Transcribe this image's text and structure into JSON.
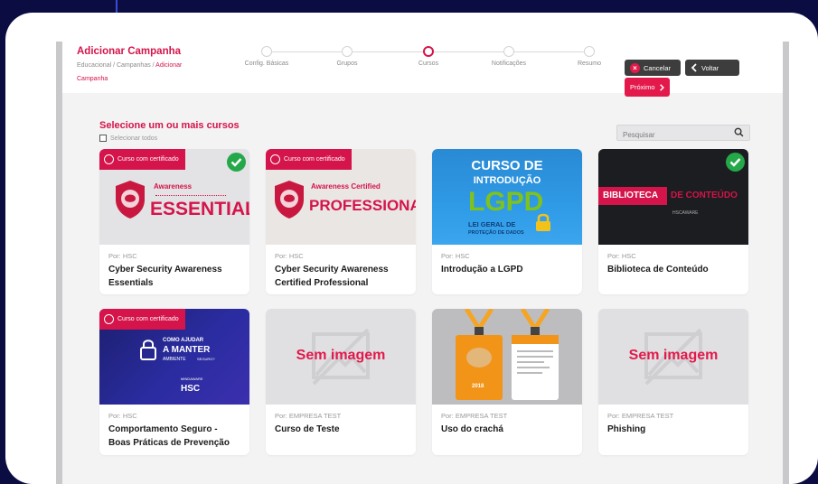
{
  "header": {
    "title": "Adicionar Campanha",
    "breadcrumb": {
      "path": "Educacional / Campanhas / ",
      "current": "Adicionar Campanha"
    }
  },
  "steps": [
    {
      "label": "Config. Básicas",
      "active": false
    },
    {
      "label": "Grupos",
      "active": false
    },
    {
      "label": "Cursos",
      "active": true
    },
    {
      "label": "Notificações",
      "active": false
    },
    {
      "label": "Resumo",
      "active": false
    }
  ],
  "actions": {
    "cancel": "Cancelar",
    "back": "Voltar",
    "next": "Próximo"
  },
  "content": {
    "title": "Selecione um ou mais cursos",
    "select_all": "Selecionar todos",
    "search_placeholder": "Pesquisar"
  },
  "colors": {
    "accent": "#d4144a",
    "success": "#25a84a",
    "dark_button": "#3d3d3d"
  },
  "courses": [
    {
      "by": "Por: HSC",
      "name": "Cyber Security Awareness Essentials",
      "certificate": "Curso com certificado",
      "selected": true,
      "image_text": {
        "small": "Awareness",
        "big": "ESSENTIALS"
      }
    },
    {
      "by": "Por: HSC",
      "name": "Cyber Security Awareness Certified Professional",
      "certificate": "Curso com certificado",
      "selected": false,
      "image_text": {
        "small": "Awareness Certified",
        "big": "PROFESSIONAL"
      }
    },
    {
      "by": "Por: HSC",
      "name": "Introdução a LGPD",
      "certificate": "",
      "selected": false,
      "image_text": {
        "line1": "CURSO DE",
        "line2": "INTRODUÇÃO",
        "big": "LGPD",
        "line3": "LEI GERAL DE",
        "line4": "PROTEÇÃO DE DADOS"
      }
    },
    {
      "by": "Por: HSC",
      "name": "Biblioteca de Conteúdo",
      "certificate": "",
      "selected": true,
      "image_text": {
        "left": "BIBLIOTECA",
        "right": "DE CONTEÚDO",
        "brand": "HSCAWARE"
      }
    },
    {
      "by": "Por: HSC",
      "name": "Comportamento Seguro - Boas Práticas de Prevenção",
      "certificate": "Curso com certificado",
      "selected": false,
      "image_text": {
        "line1": "COMO AJUDAR",
        "line2": "A MANTER",
        "line3": "AMBIENTE",
        "line4": "SEGURO?",
        "brand_small": "MINDAWARE",
        "brand": "HSC"
      }
    },
    {
      "by": "Por: EMPRESA TEST",
      "name": "Curso de Teste",
      "certificate": "",
      "selected": false,
      "no_image": "Sem imagem"
    },
    {
      "by": "Por: EMPRESA TEST",
      "name": "Uso do crachá",
      "certificate": "",
      "selected": false,
      "image_text": {
        "badge": "2018"
      }
    },
    {
      "by": "Por: EMPRESA TEST",
      "name": "Phishing",
      "certificate": "",
      "selected": false,
      "no_image": "Sem imagem"
    }
  ]
}
